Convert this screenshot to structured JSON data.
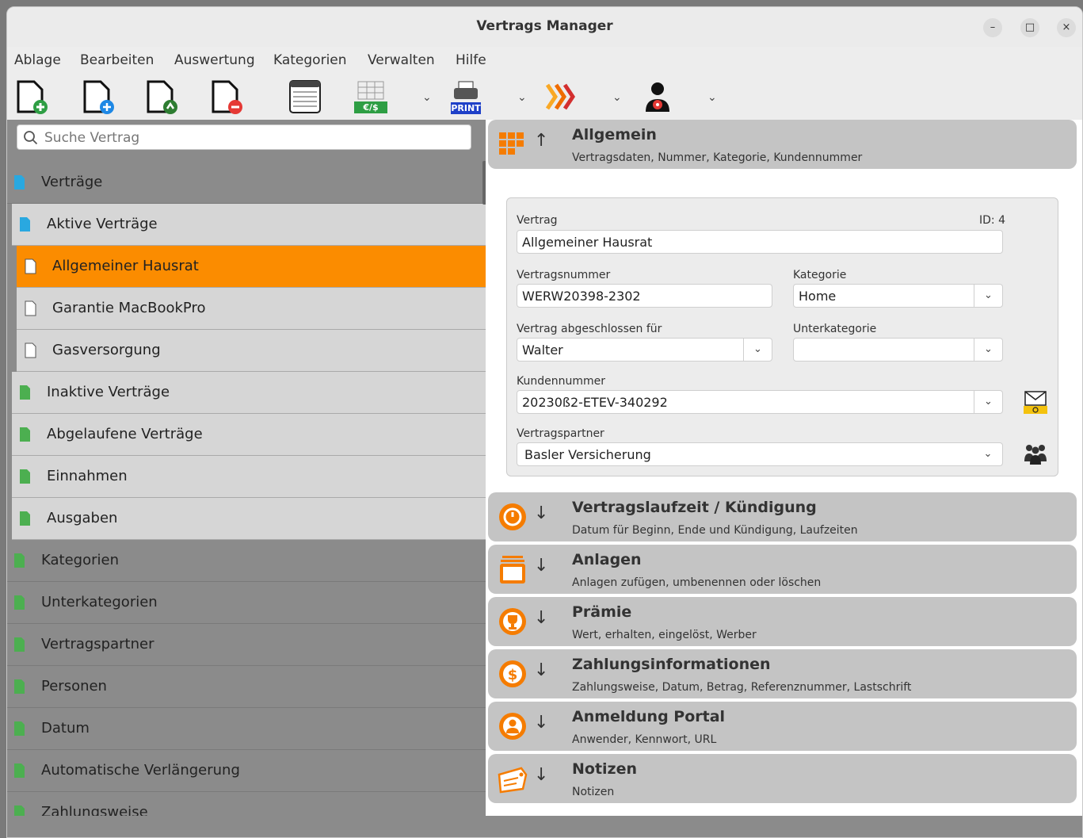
{
  "window": {
    "title": "Vertrags Manager",
    "minimize": "–",
    "maximize": "□",
    "close": "×"
  },
  "menu": [
    "Ablage",
    "Bearbeiten",
    "Auswertung",
    "Kategorien",
    "Verwalten",
    "Hilfe"
  ],
  "toolbar": {
    "print_label": "PRINT",
    "currency_label": "€/$",
    "caret": "⌄"
  },
  "search": {
    "placeholder": "Suche Vertrag"
  },
  "sidebar": {
    "items": [
      {
        "label": "Verträge"
      },
      {
        "label": "Aktive Verträge"
      },
      {
        "label": "Allgemeiner Hausrat"
      },
      {
        "label": "Garantie MacBookPro"
      },
      {
        "label": "Gasversorgung"
      },
      {
        "label": "Inaktive Verträge"
      },
      {
        "label": "Abgelaufene Verträge"
      },
      {
        "label": "Einnahmen"
      },
      {
        "label": "Ausgaben"
      },
      {
        "label": "Kategorien"
      },
      {
        "label": "Unterkategorien"
      },
      {
        "label": "Vertragspartner"
      },
      {
        "label": "Personen"
      },
      {
        "label": "Datum"
      },
      {
        "label": "Automatische Verlängerung"
      },
      {
        "label": "Zahlungsweise"
      }
    ]
  },
  "sections": [
    {
      "title": "Allgemein",
      "subtitle": "Vertragsdaten, Nummer, Kategorie, Kundennummer",
      "arrow": "↑"
    },
    {
      "title": "Vertragslaufzeit / Kündigung",
      "subtitle": "Datum für Beginn, Ende und Kündigung, Laufzeiten",
      "arrow": "↓"
    },
    {
      "title": "Anlagen",
      "subtitle": "Anlagen zufügen, umbenennen oder löschen",
      "arrow": "↓"
    },
    {
      "title": "Prämie",
      "subtitle": "Wert, erhalten, eingelöst, Werber",
      "arrow": "↓"
    },
    {
      "title": "Zahlungsinformationen",
      "subtitle": "Zahlungsweise, Datum, Betrag, Referenznummer, Lastschrift",
      "arrow": "↓"
    },
    {
      "title": "Anmeldung Portal",
      "subtitle": "Anwender, Kennwort, URL",
      "arrow": "↓"
    },
    {
      "title": "Notizen",
      "subtitle": "Notizen",
      "arrow": "↓"
    }
  ],
  "form": {
    "vertrag_label": "Vertrag",
    "id_label": "ID: 4",
    "vertrag_value": "Allgemeiner Hausrat",
    "nummer_label": "Vertragsnummer",
    "nummer_value": "WERW20398-2302",
    "kategorie_label": "Kategorie",
    "kategorie_value": "Home",
    "abgeschlossen_label": "Vertrag abgeschlossen für",
    "abgeschlossen_value": "Walter",
    "unterkategorie_label": "Unterkategorie",
    "unterkategorie_value": "",
    "kundennummer_label": "Kundennummer",
    "kundennummer_value": "20230ß2-ETEV-340292",
    "partner_label": "Vertragspartner",
    "partner_value": "Basler Versicherung",
    "dropdown_glyph": "⌄"
  },
  "colors": {
    "accent": "#fb8c00",
    "sidebar_dark": "#8b8b8b",
    "sidebar_light": "#d6d6d6",
    "section_bg": "#c4c4c4",
    "doc_blue": "#29a8e0",
    "doc_green": "#4caf50"
  }
}
